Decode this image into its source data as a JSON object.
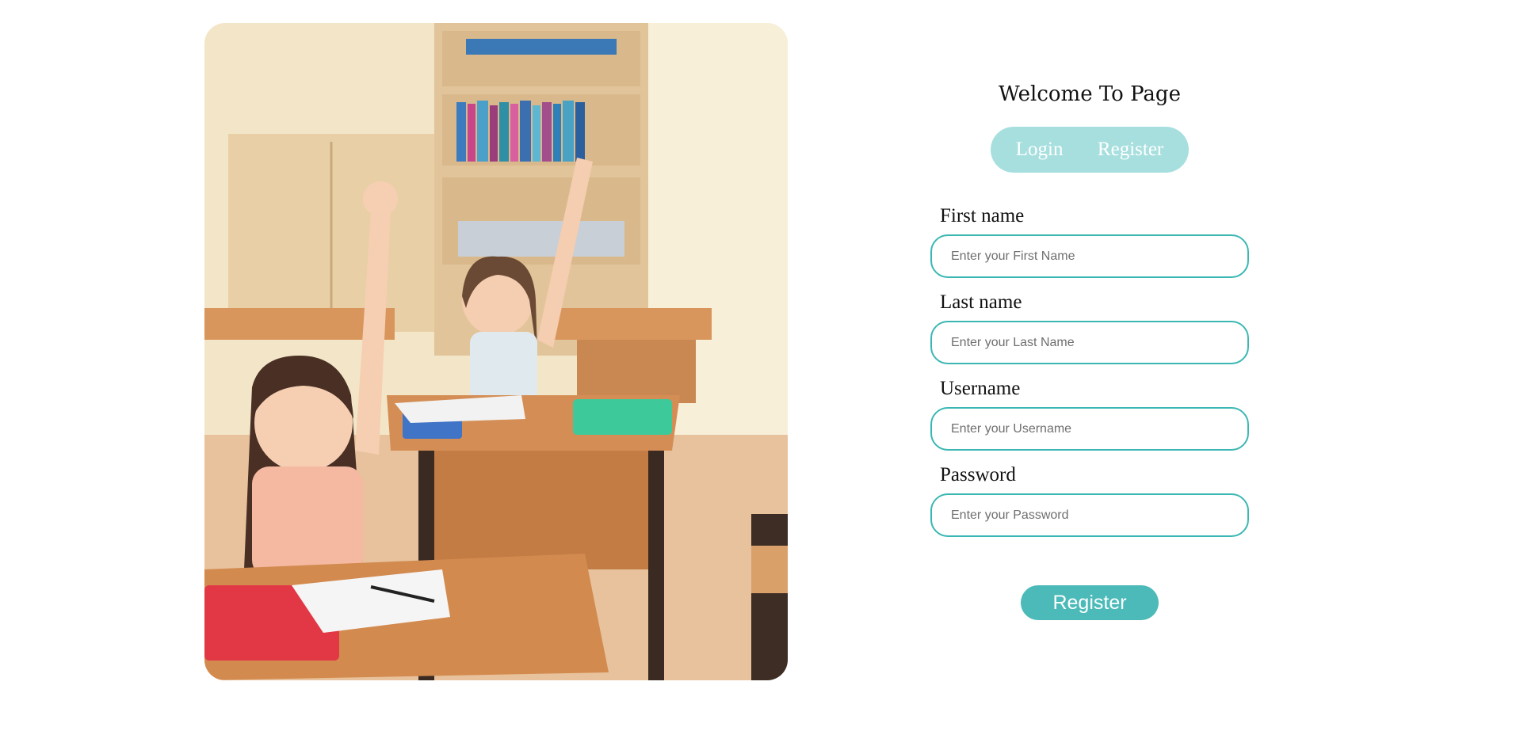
{
  "welcome_title": "Welcome To Page",
  "tabs": {
    "login_label": "Login",
    "register_label": "Register"
  },
  "form": {
    "fields": [
      {
        "label": "First name",
        "placeholder": "Enter your First Name"
      },
      {
        "label": "Last name",
        "placeholder": "Enter your Last Name"
      },
      {
        "label": "Username",
        "placeholder": "Enter your Username"
      },
      {
        "label": "Password",
        "placeholder": "Enter your Password"
      }
    ],
    "submit_label": "Register"
  },
  "colors": {
    "accent": "#3bb7b3",
    "toggle_bg": "#a7dfdf",
    "button_bg": "#4bbab8"
  }
}
